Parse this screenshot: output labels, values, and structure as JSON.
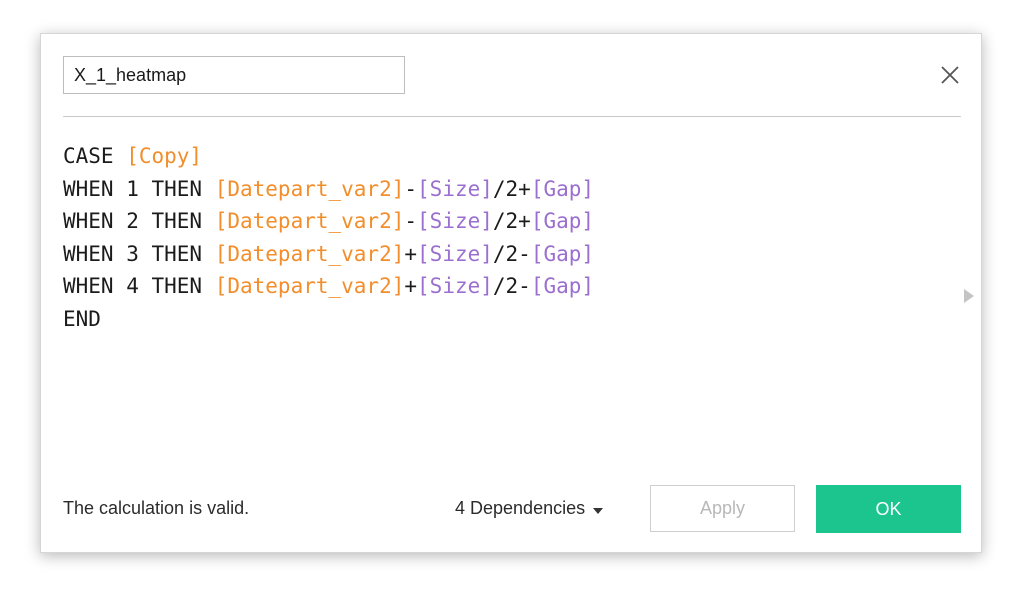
{
  "dialog": {
    "calc_name": "X_1_heatmap",
    "close_label": "×"
  },
  "editor": {
    "lines": [
      [
        {
          "t": "CASE ",
          "c": "kw"
        },
        {
          "t": "[Copy]",
          "c": "field-orange"
        }
      ],
      [
        {
          "t": "WHEN 1 THEN ",
          "c": "kw"
        },
        {
          "t": "[Datepart_var2]",
          "c": "field-orange"
        },
        {
          "t": "-",
          "c": "op"
        },
        {
          "t": "[Size]",
          "c": "field-purple"
        },
        {
          "t": "/2+",
          "c": "op"
        },
        {
          "t": "[Gap]",
          "c": "field-purple"
        }
      ],
      [
        {
          "t": "WHEN 2 THEN ",
          "c": "kw"
        },
        {
          "t": "[Datepart_var2]",
          "c": "field-orange"
        },
        {
          "t": "-",
          "c": "op"
        },
        {
          "t": "[Size]",
          "c": "field-purple"
        },
        {
          "t": "/2+",
          "c": "op"
        },
        {
          "t": "[Gap]",
          "c": "field-purple"
        }
      ],
      [
        {
          "t": "WHEN 3 THEN ",
          "c": "kw"
        },
        {
          "t": "[Datepart_var2]",
          "c": "field-orange"
        },
        {
          "t": "+",
          "c": "op"
        },
        {
          "t": "[Size]",
          "c": "field-purple"
        },
        {
          "t": "/2-",
          "c": "op"
        },
        {
          "t": "[Gap]",
          "c": "field-purple"
        }
      ],
      [
        {
          "t": "WHEN 4 THEN ",
          "c": "kw"
        },
        {
          "t": "[Datepart_var2]",
          "c": "field-orange"
        },
        {
          "t": "+",
          "c": "op"
        },
        {
          "t": "[Size]",
          "c": "field-purple"
        },
        {
          "t": "/2-",
          "c": "op"
        },
        {
          "t": "[Gap]",
          "c": "field-purple"
        }
      ],
      [
        {
          "t": "END",
          "c": "kw"
        }
      ]
    ]
  },
  "footer": {
    "status": "The calculation is valid.",
    "dependencies_label": "4 Dependencies",
    "apply_label": "Apply",
    "ok_label": "OK"
  },
  "colors": {
    "field_orange": "#f28e2b",
    "field_purple": "#9b6fcf",
    "ok_green": "#1cc48e"
  },
  "icons": {
    "close": "close-icon",
    "expand": "chevron-right-icon",
    "dependencies": "caret-down-icon"
  }
}
